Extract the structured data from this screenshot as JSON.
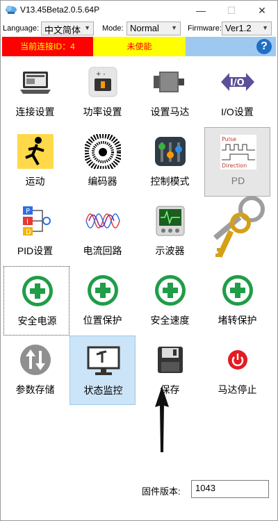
{
  "window": {
    "title": "V13.45Beta2.0.5.64P",
    "minimize": "—",
    "maximize": "☐",
    "close": "✕"
  },
  "options": {
    "language_label": "Language:",
    "language_value": "中文简体",
    "mode_label": "Mode:",
    "mode_value": "Normal",
    "firmware_label": "Firmware:",
    "firmware_value": "Ver1.2"
  },
  "status": {
    "connection_id": "当前连接ID：4",
    "enable_state": "未使能",
    "help": "?",
    "colors": {
      "red": "#ff0000",
      "yellow": "#ffff00",
      "blue": "#9fc8f0"
    }
  },
  "tiles": [
    {
      "label": "连接设置",
      "icon": "laptop-icon"
    },
    {
      "label": "功率设置",
      "icon": "battery-icon"
    },
    {
      "label": "设置马达",
      "icon": "motor-icon"
    },
    {
      "label": "I/O设置",
      "icon": "io-arrows-icon"
    },
    {
      "label": "运动",
      "icon": "running-man-icon"
    },
    {
      "label": "编码器",
      "icon": "encoder-disc-icon"
    },
    {
      "label": "控制模式",
      "icon": "mixer-knobs-icon"
    },
    {
      "label": "PD",
      "icon": "pulse-direction-icon",
      "icon_text": [
        "Pulse",
        "Direction"
      ]
    },
    {
      "label": "PID设置",
      "icon": "pid-blocks-icon",
      "icon_text": [
        "P",
        "I",
        "D"
      ]
    },
    {
      "label": "电流回路",
      "icon": "sine-waves-icon"
    },
    {
      "label": "示波器",
      "icon": "oscilloscope-icon"
    },
    {
      "label": "",
      "icon": "keys-icon"
    },
    {
      "label": "安全电源",
      "icon": "green-cross-icon"
    },
    {
      "label": "位置保护",
      "icon": "green-cross-icon"
    },
    {
      "label": "安全速度",
      "icon": "green-cross-icon"
    },
    {
      "label": "堵转保护",
      "icon": "green-cross-icon"
    },
    {
      "label": "参数存储",
      "icon": "up-down-arrows-icon"
    },
    {
      "label": "状态监控",
      "icon": "monitor-icon"
    },
    {
      "label": "保存",
      "icon": "floppy-disk-icon"
    },
    {
      "label": "马达停止",
      "icon": "power-button-icon"
    }
  ],
  "firmware_version": {
    "label": "固件版本:",
    "value": "1043"
  }
}
